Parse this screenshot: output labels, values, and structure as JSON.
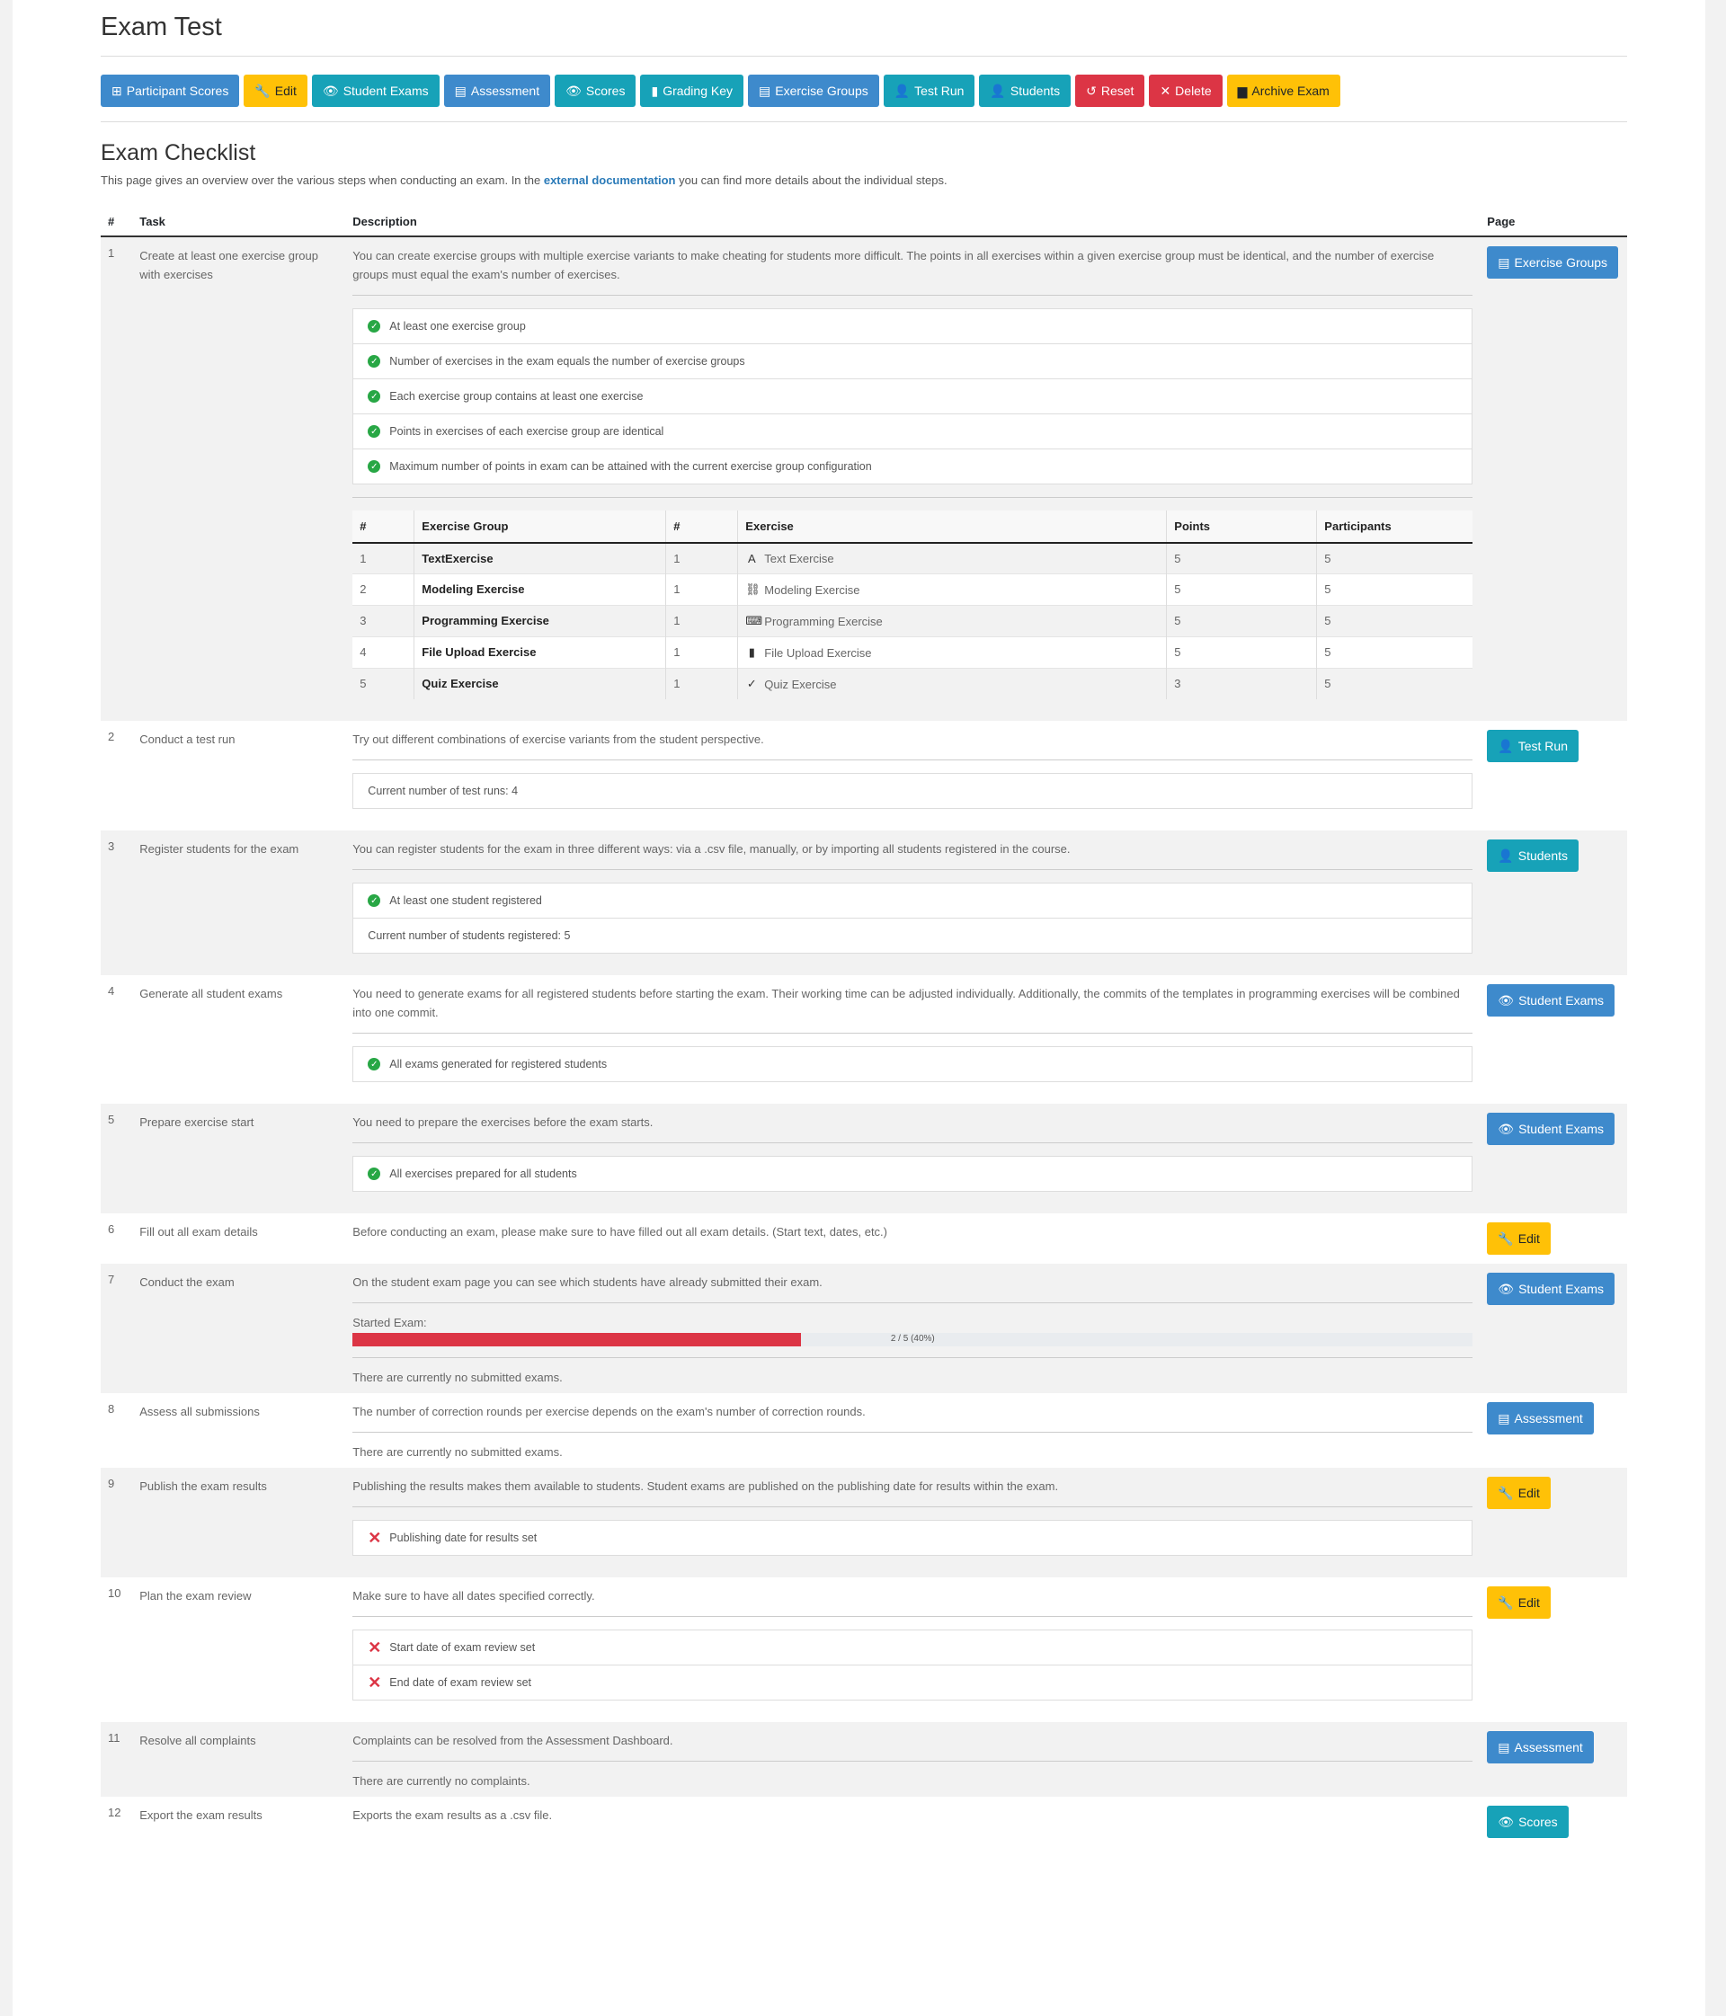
{
  "header": {
    "title": "Exam Test"
  },
  "toolbar": [
    {
      "label": "Participant Scores",
      "icon": "table-icon",
      "variant": "primary",
      "glyph": "⊞"
    },
    {
      "label": "Edit",
      "icon": "wrench-icon",
      "variant": "warning",
      "glyph": "🔧"
    },
    {
      "label": "Student Exams",
      "icon": "eye-icon",
      "variant": "info",
      "glyph": "👁"
    },
    {
      "label": "Assessment",
      "icon": "list-icon",
      "variant": "primary",
      "glyph": "▤"
    },
    {
      "label": "Scores",
      "icon": "eye-icon",
      "variant": "info",
      "glyph": "👁"
    },
    {
      "label": "Grading Key",
      "icon": "clipboard-icon",
      "variant": "info",
      "glyph": "▮"
    },
    {
      "label": "Exercise Groups",
      "icon": "list-icon",
      "variant": "primary",
      "glyph": "▤"
    },
    {
      "label": "Test Run",
      "icon": "user-icon",
      "variant": "info",
      "glyph": "👤"
    },
    {
      "label": "Students",
      "icon": "user-icon",
      "variant": "info",
      "glyph": "👤"
    },
    {
      "label": "Reset",
      "icon": "undo-icon",
      "variant": "danger",
      "glyph": "↺"
    },
    {
      "label": "Delete",
      "icon": "close-icon",
      "variant": "danger",
      "glyph": "✕"
    },
    {
      "label": "Archive Exam",
      "icon": "archive-icon",
      "variant": "warning",
      "glyph": "▆"
    }
  ],
  "checklist": {
    "heading": "Exam Checklist",
    "intro_before": "This page gives an overview over the various steps when conducting an exam. In the ",
    "intro_link": "external documentation",
    "intro_after": " you can find more details about the individual steps.",
    "columns": {
      "num": "#",
      "task": "Task",
      "description": "Description",
      "page": "Page"
    }
  },
  "exercise_table": {
    "columns": [
      "#",
      "Exercise Group",
      "#",
      "Exercise",
      "Points",
      "Participants"
    ],
    "rows": [
      {
        "num": "1",
        "group": "TextExercise",
        "n": "1",
        "exercise": "Text Exercise",
        "icon": "font-icon",
        "glyph": "A",
        "points": "5",
        "participants": "5"
      },
      {
        "num": "2",
        "group": "Modeling Exercise",
        "n": "1",
        "exercise": "Modeling Exercise",
        "icon": "project-diagram-icon",
        "glyph": "⛓",
        "points": "5",
        "participants": "5"
      },
      {
        "num": "3",
        "group": "Programming Exercise",
        "n": "1",
        "exercise": "Programming Exercise",
        "icon": "keyboard-icon",
        "glyph": "⌨",
        "points": "5",
        "participants": "5"
      },
      {
        "num": "4",
        "group": "File Upload Exercise",
        "n": "1",
        "exercise": "File Upload Exercise",
        "icon": "file-upload-icon",
        "glyph": "▮",
        "points": "5",
        "participants": "5"
      },
      {
        "num": "5",
        "group": "Quiz Exercise",
        "n": "1",
        "exercise": "Quiz Exercise",
        "icon": "check-double-icon",
        "glyph": "✓",
        "points": "3",
        "participants": "5"
      }
    ]
  },
  "steps": [
    {
      "num": "1",
      "task": "Create at least one exercise group with exercises",
      "description": "You can create exercise groups with multiple exercise variants to make cheating for students more difficult. The points in all exercises within a given exercise group must be identical, and the number of exercise groups must equal the exam's number of exercises.",
      "button": {
        "label": "Exercise Groups",
        "icon": "list-icon",
        "glyph": "▤",
        "variant": "primary"
      },
      "checks": [
        {
          "status": "ok",
          "text": "At least one exercise group"
        },
        {
          "status": "ok",
          "text": "Number of exercises in the exam equals the number of exercise groups"
        },
        {
          "status": "ok",
          "text": "Each exercise group contains at least one exercise"
        },
        {
          "status": "ok",
          "text": "Points in exercises of each exercise group are identical"
        },
        {
          "status": "ok",
          "text": "Maximum number of points in exam can be attained with the current exercise group configuration"
        }
      ],
      "has_exercise_table": true
    },
    {
      "num": "2",
      "task": "Conduct a test run",
      "description": "Try out different combinations of exercise variants from the student perspective.",
      "button": {
        "label": "Test Run",
        "icon": "user-icon",
        "glyph": "👤",
        "variant": "info"
      },
      "checks": [
        {
          "status": "none",
          "text": "Current number of test runs: 4"
        }
      ]
    },
    {
      "num": "3",
      "task": "Register students for the exam",
      "description": "You can register students for the exam in three different ways: via a .csv file, manually, or by importing all students registered in the course.",
      "button": {
        "label": "Students",
        "icon": "user-icon",
        "glyph": "👤",
        "variant": "info"
      },
      "checks": [
        {
          "status": "ok",
          "text": "At least one student registered"
        },
        {
          "status": "none",
          "text": "Current number of students registered: 5"
        }
      ]
    },
    {
      "num": "4",
      "task": "Generate all student exams",
      "description": "You need to generate exams for all registered students before starting the exam. Their working time can be adjusted individually. Additionally, the commits of the templates in programming exercises will be combined into one commit.",
      "button": {
        "label": "Student Exams",
        "icon": "eye-icon",
        "glyph": "👁",
        "variant": "primary"
      },
      "checks": [
        {
          "status": "ok",
          "text": "All exams generated for registered students"
        }
      ]
    },
    {
      "num": "5",
      "task": "Prepare exercise start",
      "description": "You need to prepare the exercises before the exam starts.",
      "button": {
        "label": "Student Exams",
        "icon": "eye-icon",
        "glyph": "👁",
        "variant": "primary"
      },
      "checks": [
        {
          "status": "ok",
          "text": "All exercises prepared for all students"
        }
      ]
    },
    {
      "num": "6",
      "task": "Fill out all exam details",
      "description": "Before conducting an exam, please make sure to have filled out all exam details. (Start text, dates, etc.)",
      "button": {
        "label": "Edit",
        "icon": "wrench-icon",
        "glyph": "🔧",
        "variant": "warning"
      },
      "checks": []
    },
    {
      "num": "7",
      "task": "Conduct the exam",
      "description": "On the student exam page you can see which students have already submitted their exam.",
      "button": {
        "label": "Student Exams",
        "icon": "eye-icon",
        "glyph": "👁",
        "variant": "primary"
      },
      "checks": [],
      "progress": {
        "label": "Started Exam:",
        "text": "2 / 5 (40%)",
        "fraction": 0.4
      },
      "note": "There are currently no submitted exams."
    },
    {
      "num": "8",
      "task": "Assess all submissions",
      "description": "The number of correction rounds per exercise depends on the exam's number of correction rounds.",
      "button": {
        "label": "Assessment",
        "icon": "list-icon",
        "glyph": "▤",
        "variant": "primary"
      },
      "checks": [],
      "note": "There are currently no submitted exams."
    },
    {
      "num": "9",
      "task": "Publish the exam results",
      "description": "Publishing the results makes them available to students. Student exams are published on the publishing date for results within the exam.",
      "button": {
        "label": "Edit",
        "icon": "wrench-icon",
        "glyph": "🔧",
        "variant": "warning"
      },
      "checks": [
        {
          "status": "bad",
          "text": "Publishing date for results set"
        }
      ]
    },
    {
      "num": "10",
      "task": "Plan the exam review",
      "description": "Make sure to have all dates specified correctly.",
      "button": {
        "label": "Edit",
        "icon": "wrench-icon",
        "glyph": "🔧",
        "variant": "warning"
      },
      "checks": [
        {
          "status": "bad",
          "text": "Start date of exam review set"
        },
        {
          "status": "bad",
          "text": "End date of exam review set"
        }
      ]
    },
    {
      "num": "11",
      "task": "Resolve all complaints",
      "description": "Complaints can be resolved from the Assessment Dashboard.",
      "button": {
        "label": "Assessment",
        "icon": "list-icon",
        "glyph": "▤",
        "variant": "primary"
      },
      "checks": [],
      "note": "There are currently no complaints."
    },
    {
      "num": "12",
      "task": "Export the exam results",
      "description": "Exports the exam results as a .csv file.",
      "button": {
        "label": "Scores",
        "icon": "eye-icon",
        "glyph": "👁",
        "variant": "info"
      },
      "checks": []
    }
  ]
}
